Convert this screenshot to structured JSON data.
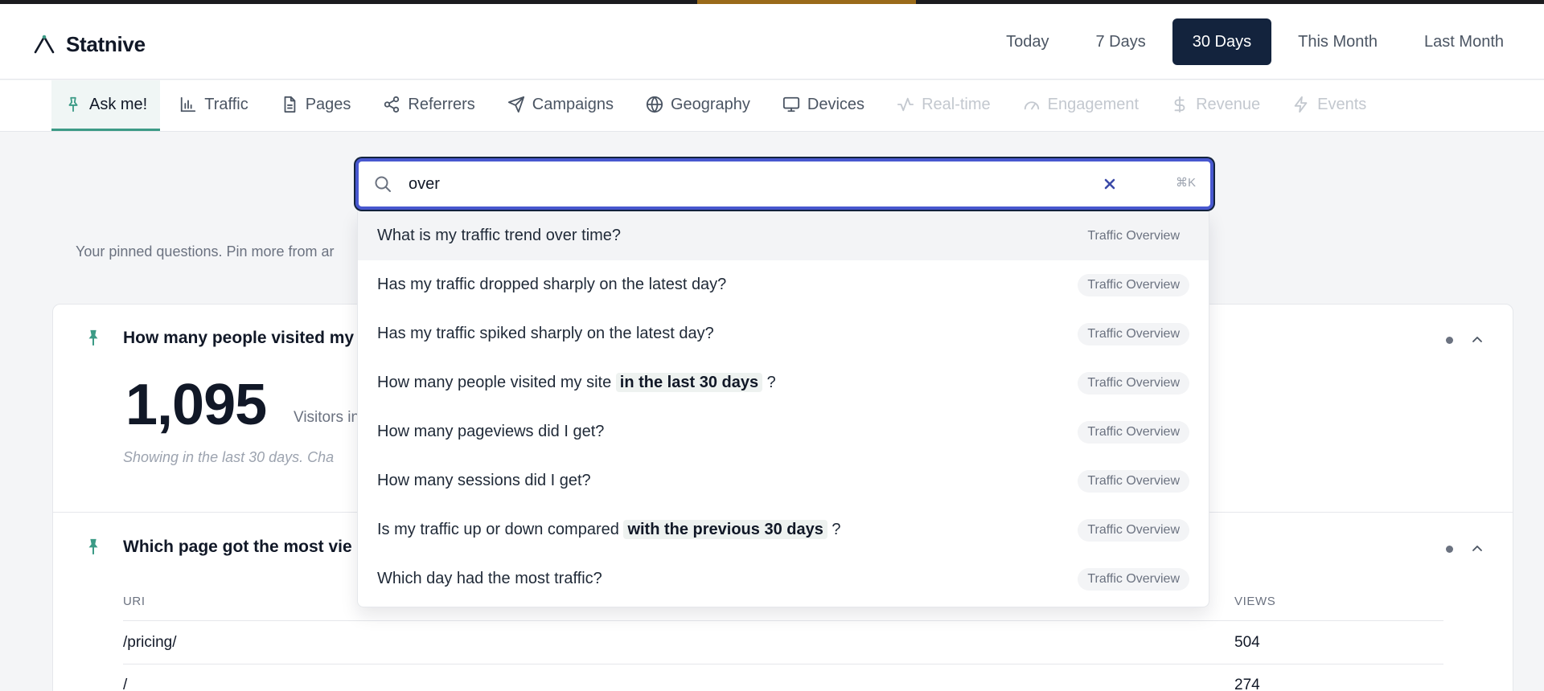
{
  "app": {
    "name": "Statnive"
  },
  "date_range": {
    "options": [
      "Today",
      "7 Days",
      "30 Days",
      "This Month",
      "Last Month"
    ],
    "selected": "30 Days"
  },
  "tabs": [
    {
      "label": "Ask me!",
      "icon": "pin-icon",
      "state": "active"
    },
    {
      "label": "Traffic",
      "icon": "bar-chart-icon",
      "state": "normal"
    },
    {
      "label": "Pages",
      "icon": "file-icon",
      "state": "normal"
    },
    {
      "label": "Referrers",
      "icon": "share-icon",
      "state": "normal"
    },
    {
      "label": "Campaigns",
      "icon": "send-icon",
      "state": "normal"
    },
    {
      "label": "Geography",
      "icon": "globe-icon",
      "state": "normal"
    },
    {
      "label": "Devices",
      "icon": "monitor-icon",
      "state": "normal"
    },
    {
      "label": "Real-time",
      "icon": "activity-icon",
      "state": "disabled"
    },
    {
      "label": "Engagement",
      "icon": "gauge-icon",
      "state": "disabled"
    },
    {
      "label": "Revenue",
      "icon": "dollar-icon",
      "state": "disabled"
    },
    {
      "label": "Events",
      "icon": "bolt-icon",
      "state": "disabled"
    }
  ],
  "search": {
    "value": "over",
    "shortcut": "⌘K",
    "suggestions": [
      {
        "pre": "What is my traffic trend over time?",
        "hl": "",
        "post": "",
        "badge": "Traffic Overview"
      },
      {
        "pre": "Has my traffic dropped sharply on the latest day?",
        "hl": "",
        "post": "",
        "badge": "Traffic Overview"
      },
      {
        "pre": "Has my traffic spiked sharply on the latest day?",
        "hl": "",
        "post": "",
        "badge": "Traffic Overview"
      },
      {
        "pre": "How many people visited my site ",
        "hl": "in the last 30 days",
        "post": " ?",
        "badge": "Traffic Overview"
      },
      {
        "pre": "How many pageviews did I get?",
        "hl": "",
        "post": "",
        "badge": "Traffic Overview"
      },
      {
        "pre": "How many sessions did I get?",
        "hl": "",
        "post": "",
        "badge": "Traffic Overview"
      },
      {
        "pre": "Is my traffic up or down compared ",
        "hl": "with the previous 30 days",
        "post": " ?",
        "badge": "Traffic Overview"
      },
      {
        "pre": "Which day had the most traffic?",
        "hl": "",
        "post": "",
        "badge": "Traffic Overview"
      }
    ]
  },
  "pinned": {
    "note": "Your pinned questions. Pin more from ar",
    "cards": [
      {
        "title": "How many people visited my",
        "value": "1,095",
        "value_label": "Visitors in",
        "note": "Showing in the last 30 days. Cha"
      },
      {
        "title": "Which page got the most vie",
        "columns": [
          "URI",
          "VIEWS"
        ],
        "rows": [
          {
            "uri": "/pricing/",
            "views": "504"
          },
          {
            "uri": "/",
            "views": "274"
          }
        ]
      }
    ]
  },
  "colors": {
    "accent_green": "#3c9b86",
    "navy": "#13233d",
    "focus_ring": "#4858d0"
  }
}
